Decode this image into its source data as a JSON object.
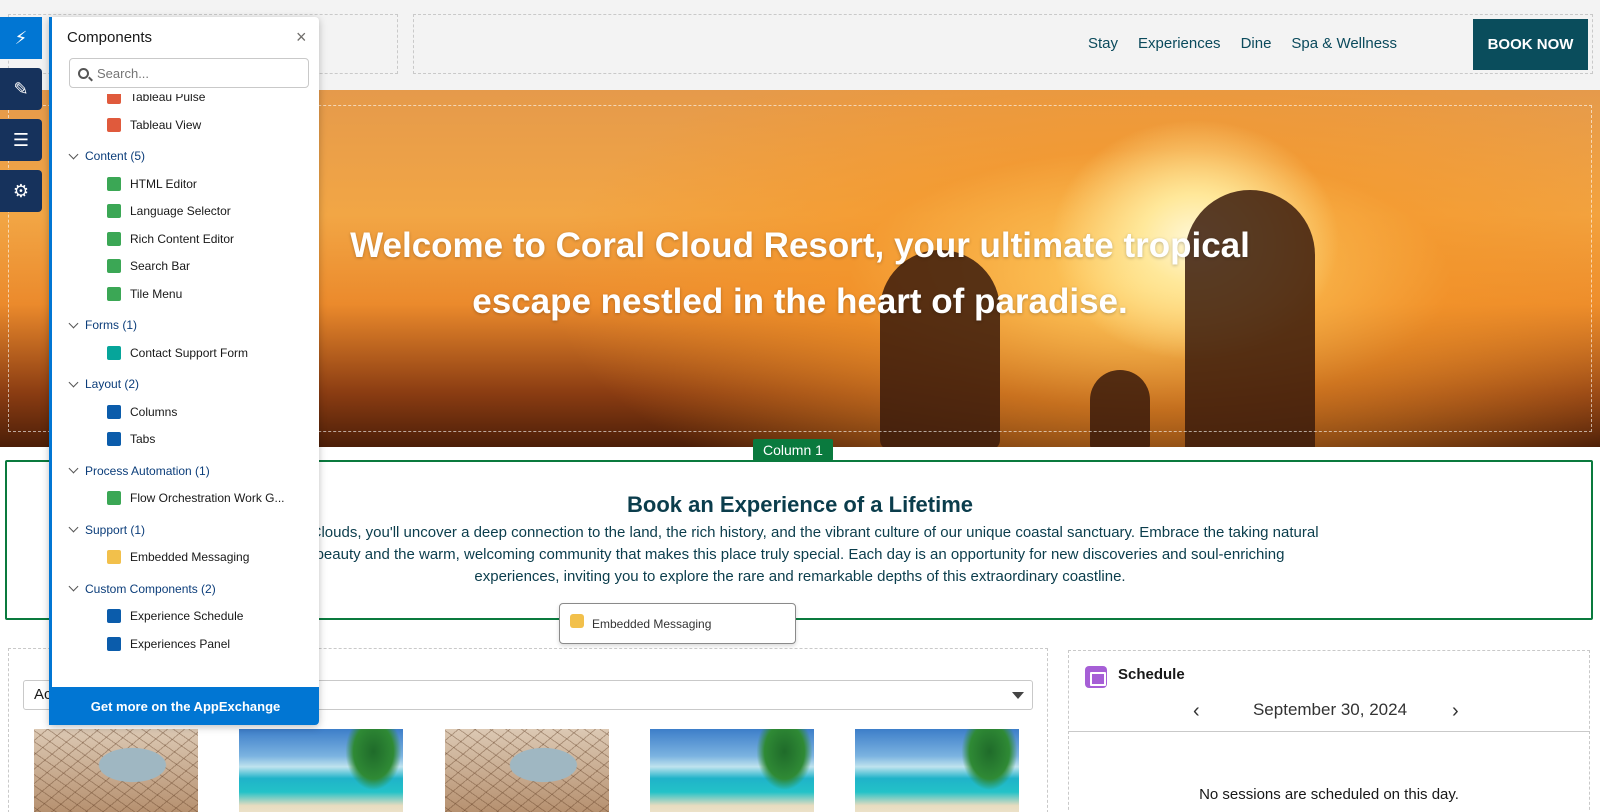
{
  "site": {
    "nav": [
      "Stay",
      "Experiences",
      "Dine",
      "Spa & Wellness"
    ],
    "book_label": "BOOK NOW",
    "hero_title": "Welcome to Coral Cloud Resort, your ultimate tropical escape nestled in the heart of paradise.",
    "column_tag": "Column 1",
    "experience_title": "Book an Experience of a Lifetime",
    "experience_body": "oral Clouds, you'll uncover a deep connection to the land, the rich history, and the vibrant culture of our unique coastal sanctuary. Embrace the taking natural beauty and the warm, welcoming community that makes this place truly special. Each day is an opportunity for new discoveries and soul-enriching experiences, inviting you to explore the rare and remarkable depths of this extraordinary coastline.",
    "select_value": "Ac",
    "thumbnails": [
      "dry",
      "beach",
      "dry",
      "beach",
      "beach"
    ],
    "schedule": {
      "title": "Schedule",
      "date": "September 30, 2024",
      "prev": "‹",
      "next": "›",
      "empty_message": "No sessions are scheduled on this day."
    }
  },
  "drag_chip": {
    "label": "Embedded Messaging"
  },
  "rail": {
    "items": [
      {
        "icon": "lightning-icon",
        "glyph": "⚡"
      },
      {
        "icon": "brush-icon",
        "glyph": "✎"
      },
      {
        "icon": "page-structure-icon",
        "glyph": "☰"
      },
      {
        "icon": "settings-icon",
        "glyph": "⚙"
      }
    ]
  },
  "components_panel": {
    "title": "Components",
    "close": "×",
    "search_placeholder": "Search...",
    "footer_label": "Get more on the AppExchange",
    "items": [
      {
        "kind": "item",
        "label": "Tableau Pulse",
        "icon": "tableau-icon",
        "color": "#e05a3c"
      },
      {
        "kind": "item",
        "label": "Tableau View",
        "icon": "tableau-icon",
        "color": "#e05a3c"
      },
      {
        "kind": "cat",
        "label": "Content (5)"
      },
      {
        "kind": "item",
        "label": "HTML Editor",
        "icon": "code-icon",
        "color": "#3ba755"
      },
      {
        "kind": "item",
        "label": "Language Selector",
        "icon": "globe-icon",
        "color": "#3ba755"
      },
      {
        "kind": "item",
        "label": "Rich Content Editor",
        "icon": "rich-text-icon",
        "color": "#3ba755"
      },
      {
        "kind": "item",
        "label": "Search Bar",
        "icon": "search-icon",
        "color": "#3ba755"
      },
      {
        "kind": "item",
        "label": "Tile Menu",
        "icon": "tile-menu-icon",
        "color": "#3ba755"
      },
      {
        "kind": "cat",
        "label": "Forms (1)"
      },
      {
        "kind": "item",
        "label": "Contact Support Form",
        "icon": "form-icon",
        "color": "#06a59a"
      },
      {
        "kind": "cat",
        "label": "Layout (2)"
      },
      {
        "kind": "item",
        "label": "Columns",
        "icon": "columns-icon",
        "color": "#0b5cab"
      },
      {
        "kind": "item",
        "label": "Tabs",
        "icon": "tabs-icon",
        "color": "#0b5cab"
      },
      {
        "kind": "cat",
        "label": "Process Automation (1)"
      },
      {
        "kind": "item",
        "label": "Flow Orchestration Work G...",
        "icon": "flow-icon",
        "color": "#3ba755"
      },
      {
        "kind": "cat",
        "label": "Support (1)"
      },
      {
        "kind": "item",
        "label": "Embedded Messaging",
        "icon": "chat-icon",
        "color": "#f2c04b"
      },
      {
        "kind": "cat",
        "label": "Custom Components (2)"
      },
      {
        "kind": "item",
        "label": "Experience Schedule",
        "icon": "custom-component-icon",
        "color": "#0b5cab"
      },
      {
        "kind": "item",
        "label": "Experiences Panel",
        "icon": "custom-component-icon",
        "color": "#0b5cab"
      }
    ]
  }
}
